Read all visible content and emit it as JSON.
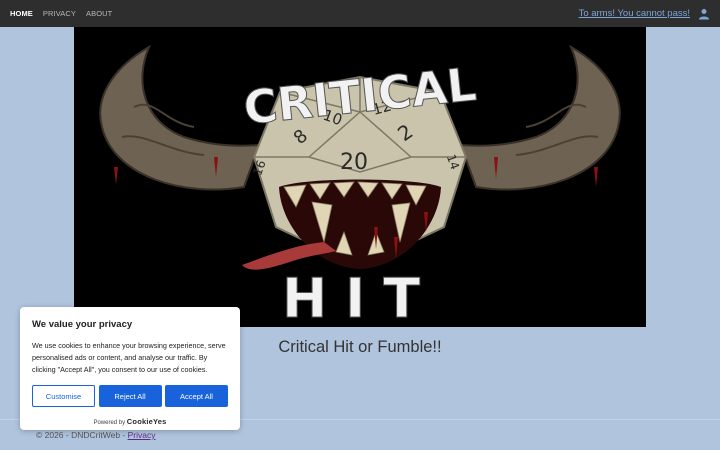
{
  "nav": {
    "items": [
      {
        "label": "HOME",
        "active": true
      },
      {
        "label": "PRIVACY",
        "active": false
      },
      {
        "label": "ABOUT",
        "active": false
      }
    ],
    "login_text": "To arms! You cannot pass!",
    "user_icon": "user-icon"
  },
  "hero": {
    "logo_words": [
      "CRITICAL",
      "HIT"
    ],
    "die_numbers": [
      "10",
      "12",
      "8",
      "2",
      "16",
      "20",
      "14"
    ]
  },
  "main": {
    "tagline": "Critical Hit or Fumble!!"
  },
  "footer": {
    "copyright": "© 2026 - DNDCritWeb - ",
    "privacy_link": "Privacy"
  },
  "cookie": {
    "title": "We value your privacy",
    "text": "We use cookies to enhance your browsing experience, serve personalised ads or content, and analyse our traffic. By clicking \"Accept All\", you consent to our use of cookies.",
    "customise_label": "Customise",
    "reject_label": "Reject All",
    "accept_label": "Accept All",
    "powered_by": "Powered by",
    "brand": "CookieYes"
  },
  "colors": {
    "page_bg": "#b0c4de",
    "navbar_bg": "#2e2e2e",
    "button_blue": "#1863dc"
  }
}
